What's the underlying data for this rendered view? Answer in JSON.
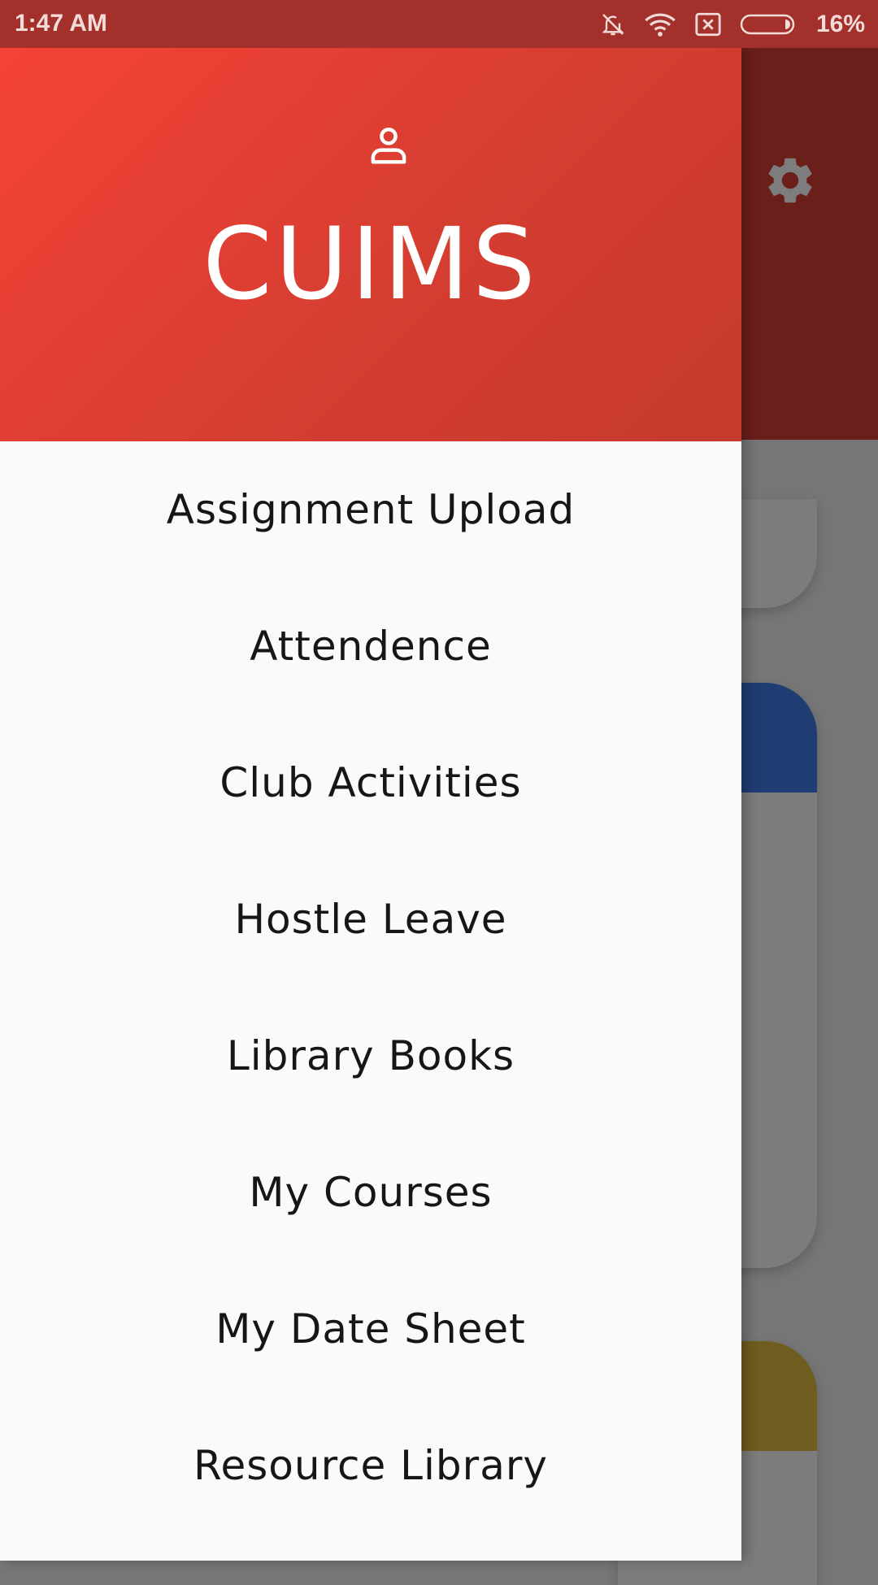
{
  "status_bar": {
    "time": "1:47 AM",
    "icons": [
      "mute-icon",
      "wifi-icon",
      "sim-error-icon",
      "battery-icon"
    ],
    "battery_percent": "16%"
  },
  "drawer": {
    "header": {
      "title": "CUIMS",
      "icon": "person-icon",
      "gradient": [
        "#f44336",
        "#c43a2c"
      ]
    },
    "menu_items": [
      {
        "label": "Assignment Upload"
      },
      {
        "label": "Attendence"
      },
      {
        "label": "Club Activities"
      },
      {
        "label": "Hostle Leave"
      },
      {
        "label": "Library Books"
      },
      {
        "label": "My Courses"
      },
      {
        "label": "My Date Sheet"
      },
      {
        "label": "Resource Library"
      }
    ]
  },
  "background_app": {
    "settings_icon": "gear-icon",
    "card_colors": [
      "#1f3d72",
      "#6f5c1f"
    ]
  }
}
